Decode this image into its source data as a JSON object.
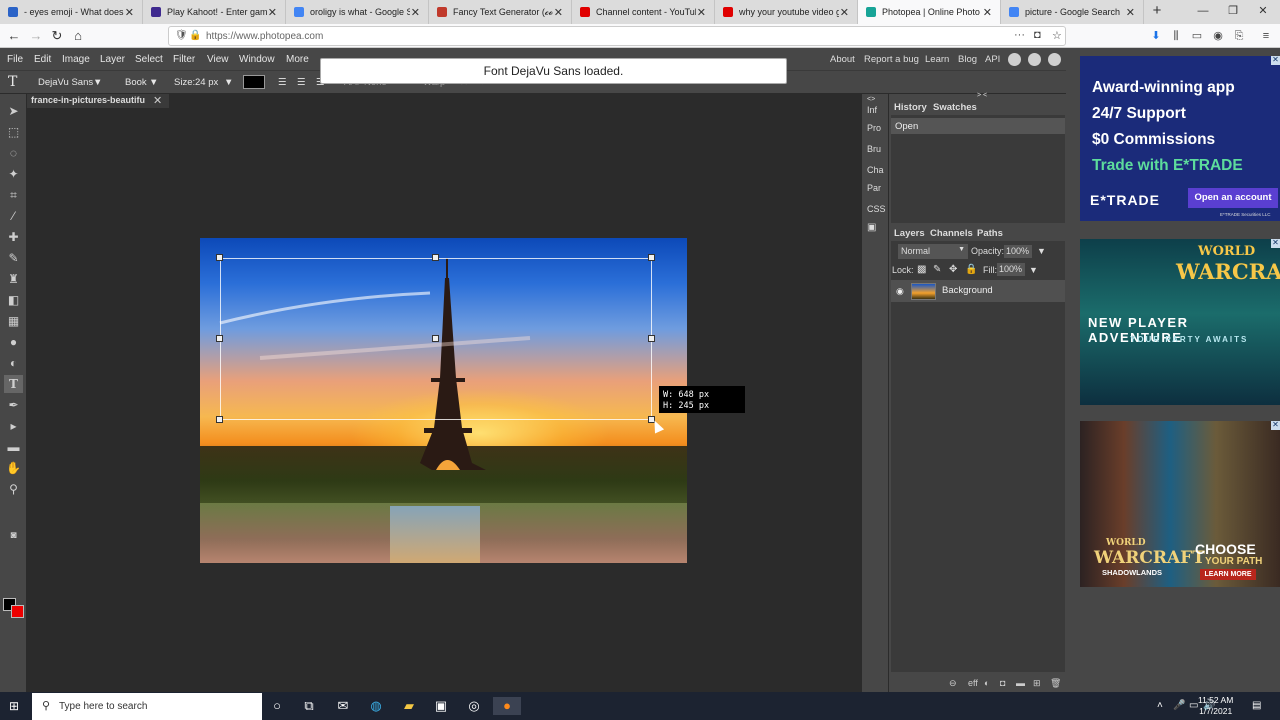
{
  "browser": {
    "tabs": [
      {
        "title": "- eyes emoji - What does",
        "color": "#2b63c7"
      },
      {
        "title": "Play Kahoot! - Enter game PI",
        "color": "#3f2a8f"
      },
      {
        "title": "oroligy is what - Google Sear",
        "color": "#4285f4"
      },
      {
        "title": "Fancy Text Generator (𝓬𝓸𝓹𝔂",
        "color": "#c0392b"
      },
      {
        "title": "Channel content - YouTube S",
        "color": "#e00000"
      },
      {
        "title": "why your youtube video got",
        "color": "#e00000"
      },
      {
        "title": "Photopea | Online Photo Edit",
        "color": "#18a497",
        "active": true
      },
      {
        "title": "picture - Google Search",
        "color": "#4285f4"
      }
    ],
    "url": "https://www.photopea.com"
  },
  "menu": {
    "items": [
      "File",
      "Edit",
      "Image",
      "Layer",
      "Select",
      "Filter",
      "View",
      "Window",
      "More"
    ],
    "right": [
      "About",
      "Report a bug",
      "Learn",
      "Blog",
      "API"
    ]
  },
  "options": {
    "font": "DejaVu Sans",
    "style": "Book",
    "size_label": "Size:",
    "size_value": "24 px",
    "aa_label": "AA:",
    "aa_value": "None",
    "warp_label": "Warp"
  },
  "toast": "Font DejaVu Sans loaded.",
  "document": {
    "tab_title": "france-in-pictures-beautifu",
    "dim_w": "W: 648 px",
    "dim_h": "H: 245 px"
  },
  "minipanel": [
    "Inf",
    "Pro",
    "Bru",
    "Cha",
    "Par",
    "CSS"
  ],
  "history": {
    "tabs": [
      "History",
      "Swatches"
    ],
    "items": [
      "Open"
    ]
  },
  "layers": {
    "tabs": [
      "Layers",
      "Channels",
      "Paths"
    ],
    "blend_mode": "Normal",
    "opacity_label": "Opacity:",
    "opacity_value": "100%",
    "lock_label": "Lock:",
    "fill_label": "Fill:",
    "fill_value": "100%",
    "layer_name": "Background",
    "footer_eff": "eff"
  },
  "ads": {
    "etrade": {
      "lines": [
        "Award-winning app",
        "24/7 Support",
        "$0 Commissions"
      ],
      "highlight": "Trade with E*TRADE",
      "logo": "E*TRADE",
      "cta": "Open an account",
      "fine": "E*TRADE Securities LLC"
    },
    "wow1": {
      "w1": "WORLD",
      "w2": "WARCRAFT",
      "t1": "NEW PLAYER ADVENTURE",
      "t2": "YOUR PARTY AWAITS"
    },
    "wow2": {
      "w1": "WORLD",
      "w2": "WARCRAFT",
      "w3": "SHADOWLANDS",
      "c1": "CHOOSE",
      "c2": "YOUR PATH",
      "c3": "LEARN MORE"
    }
  },
  "taskbar": {
    "search_placeholder": "Type here to search",
    "time": "11:52 AM",
    "date": "1/7/2021"
  }
}
